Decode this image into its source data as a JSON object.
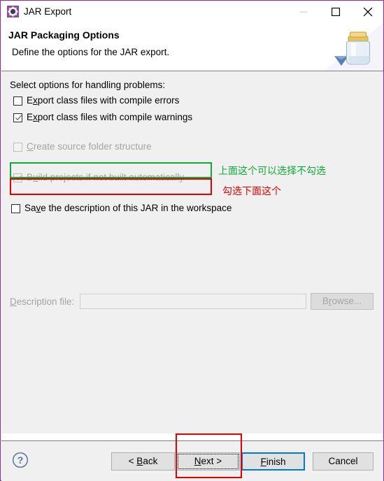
{
  "window": {
    "title": "JAR Export",
    "icon": "eclipse-gear-icon",
    "border_color": "#a0249b",
    "controls": {
      "minimize_label": "minimize-icon",
      "minimize_enabled": false,
      "maximize_label": "maximize-icon",
      "close_label": "close-icon"
    }
  },
  "header": {
    "title": "JAR Packaging Options",
    "description": "Define the options for the JAR export.",
    "image": "jar-export-icon"
  },
  "content": {
    "group_label": "Select options for handling problems:",
    "checkboxes": [
      {
        "label_pre": "E",
        "label_mnemonic": "x",
        "label_post": "port class files with compile errors",
        "full_label": "Export class files with compile errors",
        "checked": false,
        "enabled": true
      },
      {
        "label_pre": "E",
        "label_mnemonic": "x",
        "label_post": "port class files with compile warnings",
        "full_label": "Export class files with compile warnings",
        "checked": true,
        "enabled": true
      },
      {
        "label_pre": "",
        "label_mnemonic": "C",
        "label_post": "reate source folder structure",
        "full_label": "Create source folder structure",
        "checked": false,
        "enabled": false
      },
      {
        "label_pre": "B",
        "label_mnemonic": "u",
        "label_post": "ild projects if not built automatically",
        "full_label": "Build projects if not built automatically",
        "checked": true,
        "enabled": false
      },
      {
        "label_pre": "Sa",
        "label_mnemonic": "v",
        "label_post": "e the description of this JAR in the workspace",
        "full_label": "Save the description of this JAR in the workspace",
        "checked": false,
        "enabled": true
      }
    ],
    "description_file": {
      "label_pre": "",
      "label_mnemonic": "D",
      "label_post": "escription file:",
      "full_label": "Description file:",
      "value": "",
      "placeholder": "",
      "enabled": false
    },
    "browse_button": {
      "label_pre": "B",
      "label_mnemonic": "r",
      "label_post": "owse...",
      "full_label": "Browse...",
      "enabled": false
    }
  },
  "footer": {
    "help_icon": "help-question-icon",
    "buttons": [
      {
        "name": "back",
        "label_pre": "< ",
        "label_mnemonic": "B",
        "label_post": "ack",
        "full_label": "< Back",
        "focused": false,
        "default": false
      },
      {
        "name": "next",
        "label_pre": "",
        "label_mnemonic": "N",
        "label_post": "ext >",
        "full_label": "Next >",
        "focused": true,
        "default": false
      },
      {
        "name": "finish",
        "label_pre": "",
        "label_mnemonic": "F",
        "label_post": "inish",
        "full_label": "Finish",
        "focused": false,
        "default": true
      },
      {
        "name": "cancel",
        "label_pre": "",
        "label_mnemonic": "",
        "label_post": "Cancel",
        "full_label": "Cancel",
        "focused": false,
        "default": false
      }
    ]
  },
  "annotations": {
    "green_color": "#10a838",
    "red_color": "#e60000",
    "green_text": "上面这个可以选择不勾选",
    "red_text": "勾选下面这个",
    "green_box_target": "Export class files with compile errors",
    "red_box_target": "Export class files with compile warnings",
    "next_box_target": "Next >"
  }
}
